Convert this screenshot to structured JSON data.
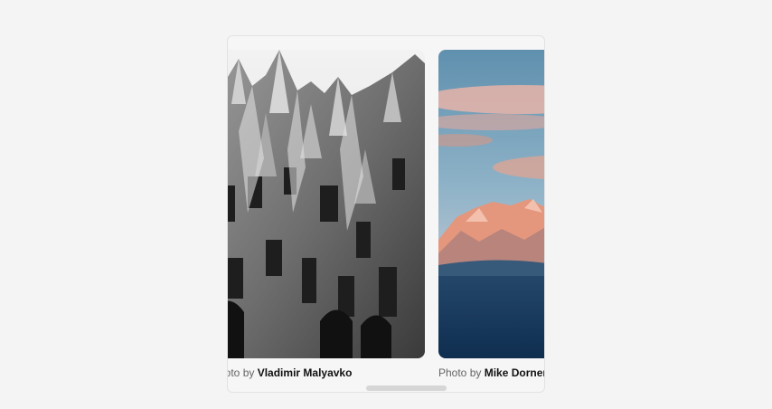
{
  "gallery": {
    "photos": [
      {
        "subject": "black and white modern building facade",
        "caption_prefix": "Photo by",
        "author": "Vladimir Malyavko"
      },
      {
        "subject": "snowy mountain range at sunset",
        "caption_prefix": "Photo by",
        "author": "Mike Dorner"
      }
    ]
  },
  "colors": {
    "page_background": "#f4f4f4",
    "caption_text": "#666666",
    "author_text": "#111111",
    "scrollbar_thumb": "#d6d6d6"
  }
}
